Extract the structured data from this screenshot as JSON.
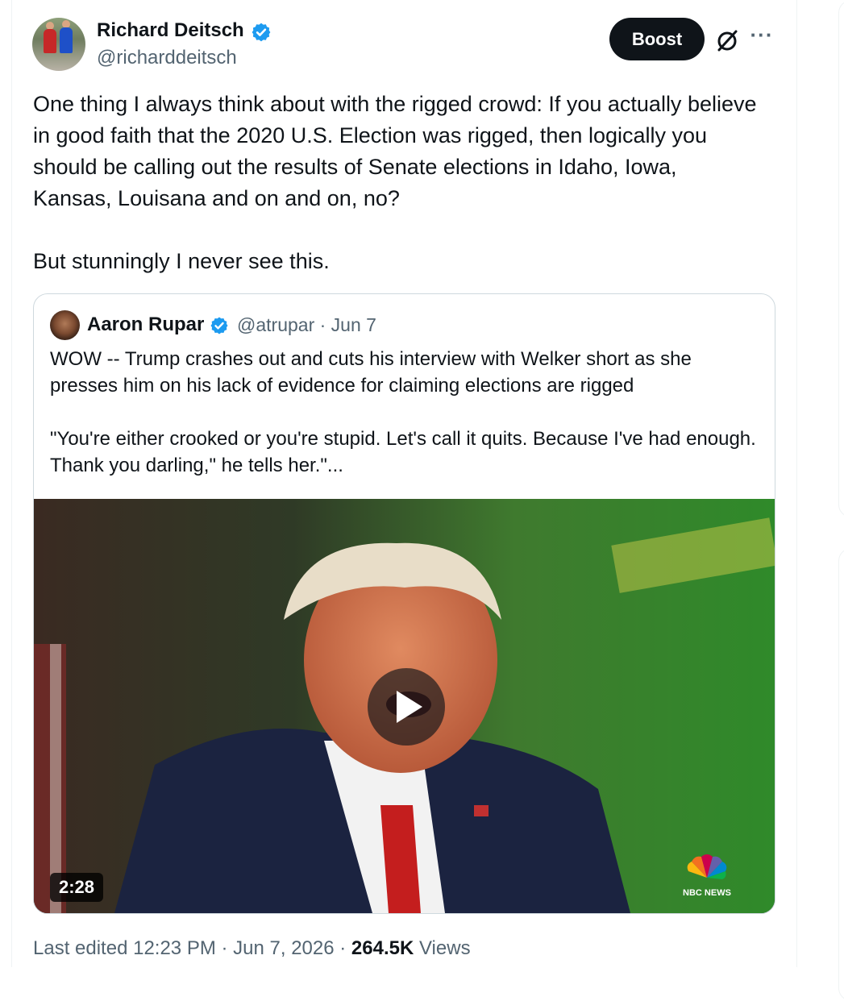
{
  "author": {
    "name": "Richard Deitsch",
    "handle": "@richarddeitsch"
  },
  "actions": {
    "boost_label": "Boost",
    "grok_icon": "grok-icon",
    "more_icon": "more-icon"
  },
  "tweet": {
    "text": "One thing I always think about with the rigged crowd: If you actually believe in good faith that the 2020 U.S. Election was rigged, then logically you should be calling out the results of Senate elections in Idaho, Iowa, Kansas, Louisana and on and on, no?\n\nBut stunningly I never see this."
  },
  "quote": {
    "name": "Aaron Rupar",
    "handle_date": "@atrupar · Jun 7",
    "text": "WOW -- Trump crashes out and cuts his interview with Welker short as she presses him on his lack of evidence for claiming elections are rigged\n\n\"You're either crooked or you're stupid. Let's call it quits. Because I've had enough. Thank you darling,\" he tells her.\"...",
    "video": {
      "duration": "2:28",
      "watermark": "NBC NEWS"
    }
  },
  "footer": {
    "edited": "Last edited 12:23 PM · Jun 7, 2026 · ",
    "views_count": "264.5K",
    "views_label": " Views"
  },
  "colors": {
    "verified_blue": "#1d9bf0",
    "text_primary": "#0f1419",
    "text_secondary": "#536471",
    "border": "#cfd9de"
  }
}
